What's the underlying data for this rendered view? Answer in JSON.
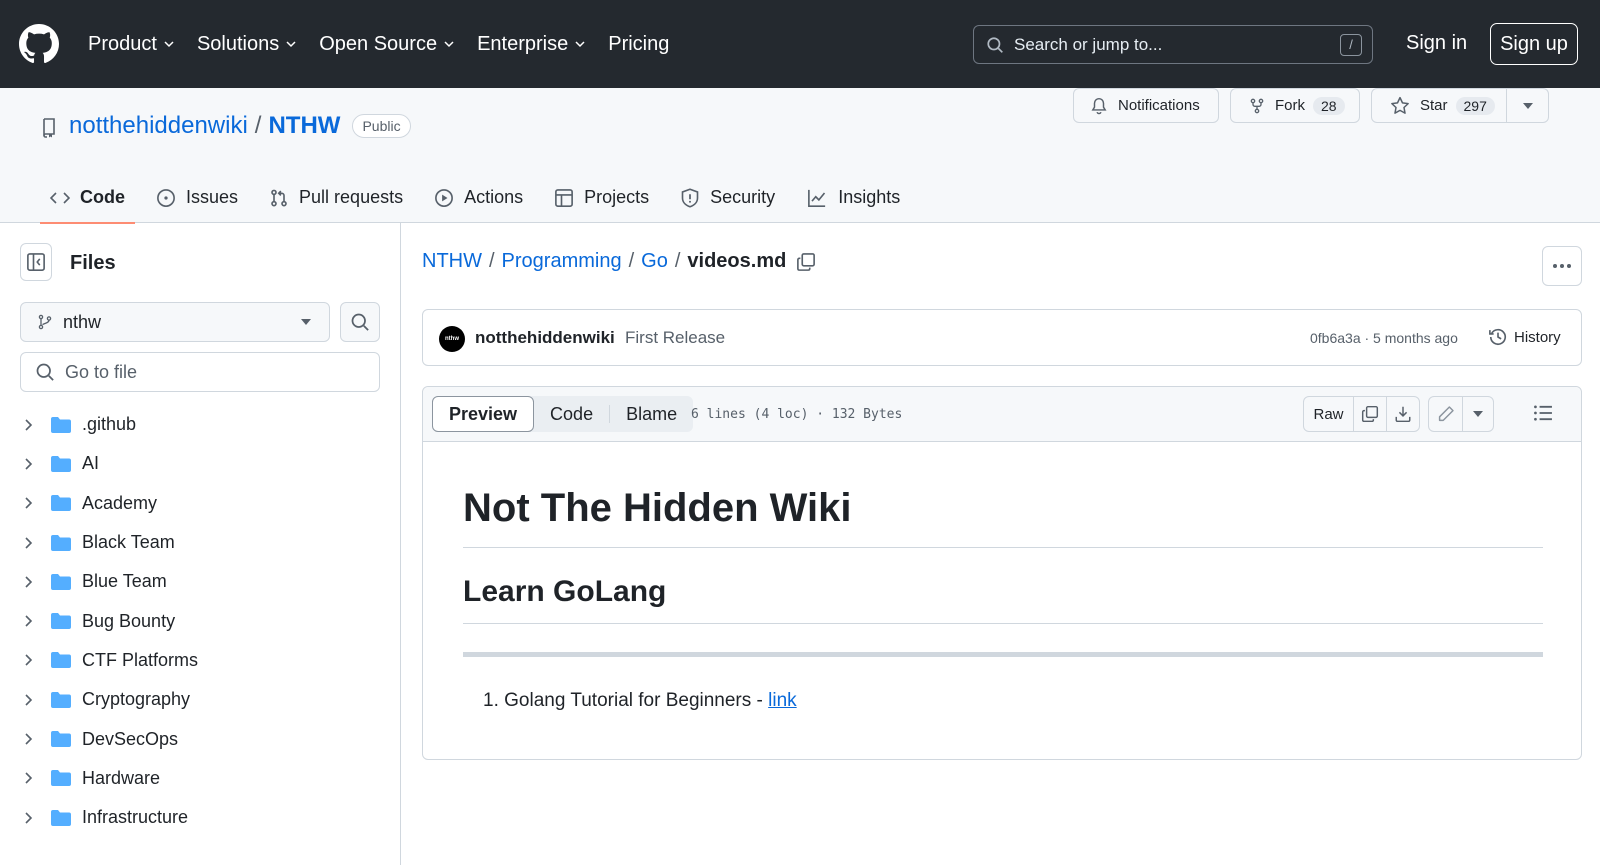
{
  "header": {
    "nav": [
      {
        "label": "Product",
        "has_menu": true
      },
      {
        "label": "Solutions",
        "has_menu": true
      },
      {
        "label": "Open Source",
        "has_menu": true
      },
      {
        "label": "Enterprise",
        "has_menu": true
      },
      {
        "label": "Pricing",
        "has_menu": false
      }
    ],
    "search_placeholder": "Search or jump to...",
    "search_shortcut": "/",
    "sign_in": "Sign in",
    "sign_up": "Sign up"
  },
  "repo": {
    "owner": "notthehiddenwiki",
    "separator": "/",
    "name": "NTHW",
    "visibility": "Public",
    "notifications_label": "Notifications",
    "fork_label": "Fork",
    "fork_count": "28",
    "star_label": "Star",
    "star_count": "297",
    "tabs": [
      {
        "label": "Code",
        "icon": "code-icon",
        "active": true
      },
      {
        "label": "Issues",
        "icon": "issue-icon",
        "active": false
      },
      {
        "label": "Pull requests",
        "icon": "pull-request-icon",
        "active": false
      },
      {
        "label": "Actions",
        "icon": "play-icon",
        "active": false
      },
      {
        "label": "Projects",
        "icon": "table-icon",
        "active": false
      },
      {
        "label": "Security",
        "icon": "shield-icon",
        "active": false
      },
      {
        "label": "Insights",
        "icon": "graph-icon",
        "active": false
      }
    ]
  },
  "sidebar": {
    "title": "Files",
    "branch": "nthw",
    "goto_placeholder": "Go to file",
    "tree": [
      {
        "label": ".github"
      },
      {
        "label": "AI"
      },
      {
        "label": "Academy"
      },
      {
        "label": "Black Team"
      },
      {
        "label": "Blue Team"
      },
      {
        "label": "Bug Bounty"
      },
      {
        "label": "CTF Platforms"
      },
      {
        "label": "Cryptography"
      },
      {
        "label": "DevSecOps"
      },
      {
        "label": "Hardware"
      },
      {
        "label": "Infrastructure"
      }
    ]
  },
  "breadcrumb": {
    "parts": [
      "NTHW",
      "Programming",
      "Go"
    ],
    "separator": "/",
    "current": "videos.md"
  },
  "commit": {
    "avatar_text": "nthw",
    "author": "notthehiddenwiki",
    "message": "First Release",
    "hash_time": "0fb6a3a · 5 months ago",
    "history_label": "History"
  },
  "file": {
    "views": [
      "Preview",
      "Code",
      "Blame"
    ],
    "active_view": "Preview",
    "info": "6 lines (4 loc) · 132 Bytes",
    "raw_label": "Raw"
  },
  "markdown": {
    "h1": "Not The Hidden Wiki",
    "h2": "Learn GoLang",
    "list_item_prefix": "1. Golang Tutorial for Beginners - ",
    "list_item_link": "link"
  },
  "colors": {
    "header_bg": "#24292f",
    "accent_link": "#0969da",
    "active_tab_underline": "#fd8c73",
    "folder": "#54aeff"
  }
}
